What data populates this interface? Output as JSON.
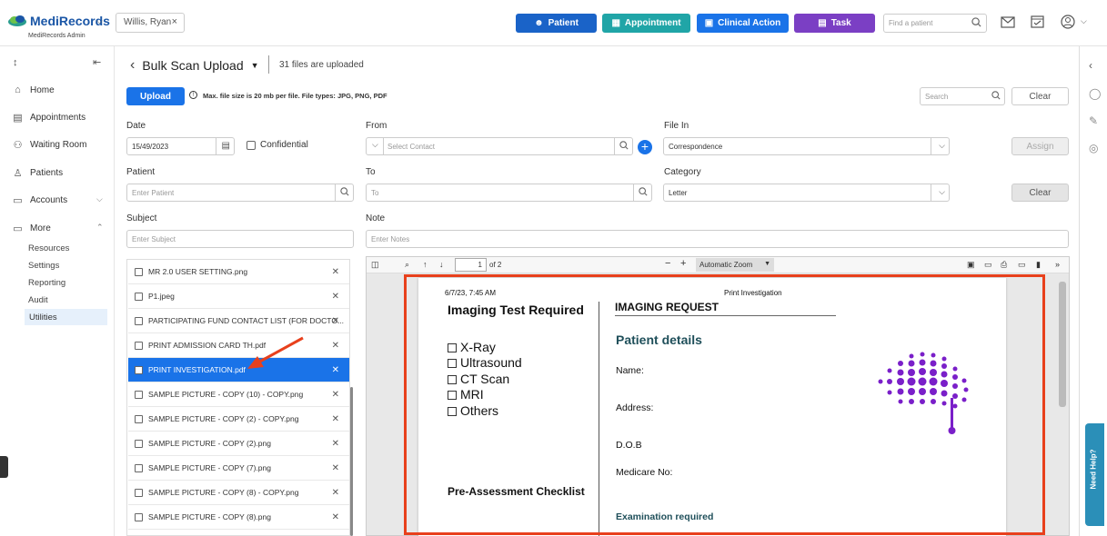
{
  "header": {
    "logo_text": "MediRecords",
    "logo_sub": "MediRecords Admin",
    "patient_chip": "Willis, Ryan",
    "buttons": [
      {
        "label": "Patient",
        "color": "#1a63c8"
      },
      {
        "label": "Appointment",
        "color": "#20a5a7"
      },
      {
        "label": "Clinical Action",
        "color": "#1a73e8"
      },
      {
        "label": "Task",
        "color": "#7b3fc4"
      }
    ],
    "find_placeholder": "Find a patient"
  },
  "sidebar": {
    "items": [
      "Home",
      "Appointments",
      "Waiting Room",
      "Patients",
      "Accounts",
      "More"
    ],
    "subitems": [
      "Resources",
      "Settings",
      "Reporting",
      "Audit",
      "Utilities"
    ],
    "active": "Utilities"
  },
  "page": {
    "title": "Bulk Scan Upload",
    "uploaded_count": "31 files are uploaded",
    "upload_button": "Upload",
    "upload_note": "Max. file size is 20 mb per file. File types: JPG, PNG, PDF",
    "search_placeholder": "Search",
    "clear_top": "Clear"
  },
  "form": {
    "date_label": "Date",
    "date_value": "15/49/2023",
    "confidential_label": "Confidential",
    "from_label": "From",
    "from_placeholder": "Select Contact",
    "filein_label": "File In",
    "filein_value": "Correspondence",
    "assign_button": "Assign",
    "patient_label": "Patient",
    "patient_placeholder": "Enter Patient",
    "to_label": "To",
    "to_placeholder": "To",
    "category_label": "Category",
    "category_value": "Letter",
    "clear_button": "Clear",
    "subject_label": "Subject",
    "subject_placeholder": "Enter Subject",
    "note_label": "Note",
    "note_placeholder": "Enter Notes"
  },
  "files": [
    {
      "name": "MR 2.0 USER SETTING.png",
      "selected": false
    },
    {
      "name": "P1.jpeg",
      "selected": false
    },
    {
      "name": "PARTICIPATING FUND CONTACT LIST (FOR DOCTO...",
      "selected": false
    },
    {
      "name": "PRINT ADMISSION CARD TH.pdf",
      "selected": false
    },
    {
      "name": "PRINT INVESTIGATION.pdf",
      "selected": true
    },
    {
      "name": "SAMPLE PICTURE - COPY (10) - COPY.png",
      "selected": false
    },
    {
      "name": "SAMPLE PICTURE - COPY (2) - COPY.png",
      "selected": false
    },
    {
      "name": "SAMPLE PICTURE - COPY (2).png",
      "selected": false
    },
    {
      "name": "SAMPLE PICTURE - COPY (7).png",
      "selected": false
    },
    {
      "name": "SAMPLE PICTURE - COPY (8) - COPY.png",
      "selected": false
    },
    {
      "name": "SAMPLE PICTURE - COPY (8).png",
      "selected": false
    }
  ],
  "viewer": {
    "page_current": "1",
    "page_total": "of 2",
    "zoom": "Automatic Zoom"
  },
  "document": {
    "timestamp": "6/7/23, 7:45 AM",
    "header_title": "Print Investigation",
    "imaging_test_title": "Imaging Test Required",
    "imaging_request_title": "IMAGING REQUEST",
    "tests": [
      "X-Ray",
      "Ultrasound",
      "CT Scan",
      "MRI",
      "Others"
    ],
    "patient_details_title": "Patient details",
    "fields": [
      "Name:",
      "Address:",
      "D.O.B",
      "Medicare No:"
    ],
    "pre_assessment": "Pre-Assessment Checklist",
    "examination": "Examination required"
  },
  "help_tab": "Need Help?"
}
